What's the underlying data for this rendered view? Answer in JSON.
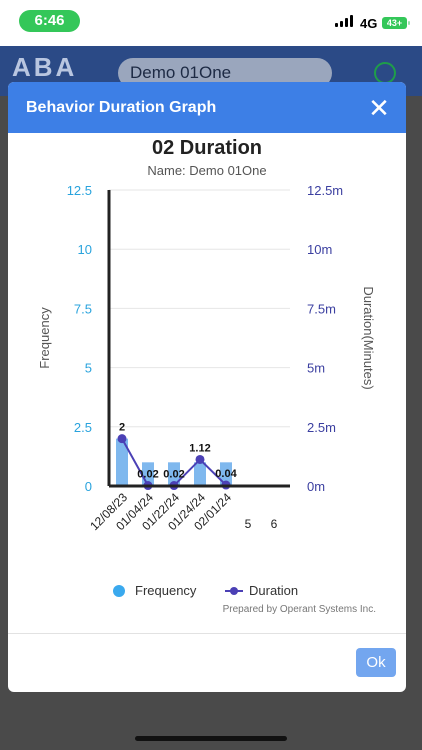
{
  "status_bar": {
    "time": "6:46",
    "network": "4G",
    "battery": "43+"
  },
  "background_app": {
    "logo": "ABA",
    "client_selector": "Demo 01One"
  },
  "modal": {
    "title": "Behavior Duration Graph",
    "close_label": "✕",
    "ok_label": "Ok",
    "prepared_by": "Prepared by Operant Systems Inc."
  },
  "chart_data": {
    "type": "bar",
    "title": "02 Duration",
    "subtitle": "Name: Demo 01One",
    "categories": [
      "12/08/23",
      "01/04/24",
      "01/22/24",
      "01/24/24",
      "02/01/24"
    ],
    "extra_x_ticks": [
      "5",
      "6"
    ],
    "series": [
      {
        "name": "Frequency",
        "type": "bar",
        "axis": "left",
        "values": [
          2,
          1,
          1,
          1,
          1
        ],
        "color": "#7fb8ee"
      },
      {
        "name": "Duration",
        "type": "line",
        "axis": "right",
        "values": [
          2,
          0.02,
          0.02,
          1.12,
          0.04
        ],
        "labels": [
          "2",
          "0.02",
          "0.02",
          "1.12",
          "0.04"
        ],
        "color": "#4b40b5"
      }
    ],
    "ylabel": "Frequency",
    "y2label": "Duration(Minutes)",
    "ylim": [
      0,
      12.5
    ],
    "yticks": [
      "0",
      "2.5",
      "5",
      "7.5",
      "10",
      "12.5"
    ],
    "y2lim": [
      0,
      12.5
    ],
    "y2ticks": [
      "0m",
      "2.5m",
      "5m",
      "7.5m",
      "10m",
      "12.5m"
    ],
    "left_axis_color": "#29a3dd",
    "right_axis_color": "#3b3fa0",
    "grid": true,
    "legend_position": "bottom"
  }
}
